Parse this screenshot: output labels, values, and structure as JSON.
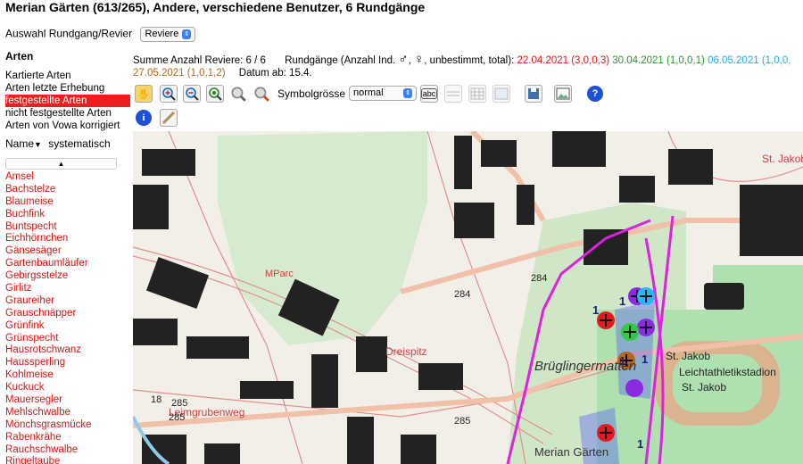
{
  "title": "Merian Gärten (613/265), Andere, verschiedene Benutzer, 6 Rundgänge",
  "revier": {
    "label": "Auswahl Rundgang/Revier",
    "selected": "Reviere"
  },
  "arten": {
    "heading": "Arten",
    "nav": [
      "Kartierte Arten",
      "Arten letzte Erhebung",
      "festgestellte Arten",
      "nicht festgestellte Arten",
      "Arten von Vowa korrigiert"
    ],
    "active_index": 2,
    "sort_name": "Name",
    "sort_systematic": "systematisch",
    "species": [
      "Amsel",
      "Bachstelze",
      "Blaumeise",
      "Buchfink",
      "Buntspecht",
      "Eichhörnchen",
      "Gänsesäger",
      "Gartenbaumläufer",
      "Gebirgsstelze",
      "Girlitz",
      "Graureiher",
      "Grauschnäpper",
      "Grünfink",
      "Grünspecht",
      "Hausrotschwanz",
      "Haussperling",
      "Kohlmeise",
      "Kuckuck",
      "Mauersegler",
      "Mehlschwalbe",
      "Mönchsgrasmücke",
      "Rabenkrähe",
      "Rauchschwalbe",
      "Ringeltaube"
    ]
  },
  "summary": {
    "reviere": "Summe Anzahl Reviere: 6 / 6",
    "rundgaenge_prefix": "Rundgänge (Anzahl Ind.",
    "male": "♂",
    "female": "♀",
    "rundgaenge_suffix": ", unbestimmt, total):",
    "dates": [
      {
        "text": "22.04.2021 (3,0,0,3)",
        "color": "red"
      },
      {
        "text": "30.04.2021 (1,0,0,1)",
        "color": "green"
      },
      {
        "text": "06.05.2021 (1,0,0,",
        "color": "blue"
      }
    ],
    "date_line2": {
      "text": "27.05.2021 (1,0,1,2)",
      "color": "brown"
    },
    "datum_ab": "Datum ab: 15.4."
  },
  "toolbar": {
    "symbol_label": "Symbolgrösse",
    "symbol_size": "normal",
    "icons": [
      "hand-pan-icon",
      "zoom-in-icon",
      "zoom-out-icon",
      "zoom-extent-icon",
      "zoom-grey-icon",
      "zoom-search-icon",
      "text-label-icon",
      "line-icon",
      "grid-icon",
      "map-layer-icon",
      "save-icon",
      "image-icon",
      "help-icon",
      "info-icon",
      "ruler-icon"
    ]
  },
  "map": {
    "labels": [
      "Brüglingermatten",
      "St. Jakob",
      "Leichtathletikstadion",
      "St. Jakob",
      "Merian Gärten",
      "Dreispitz",
      "Leimgrubenweg",
      "MParc",
      "285",
      "284",
      "284",
      "285",
      "285",
      "18",
      "St. Jakob"
    ],
    "marker_counts": [
      "1",
      "1",
      "1",
      "1",
      "1"
    ],
    "colors": {
      "red": "#e41a1c",
      "green": "#2ecc40",
      "purple": "#8a2be2",
      "brown": "#b5651d",
      "blue": "#29b6f6",
      "route": "#e020e0"
    }
  }
}
